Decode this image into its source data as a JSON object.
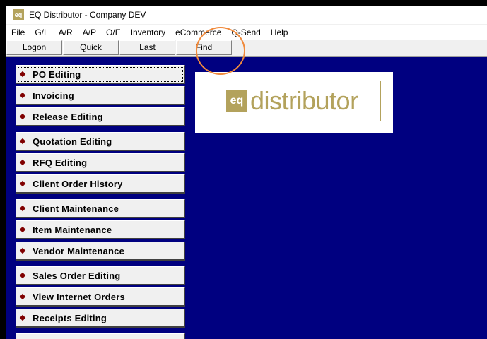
{
  "window": {
    "title": "EQ Distributor - Company DEV",
    "icon_text": "eq"
  },
  "menu": [
    "File",
    "G/L",
    "A/R",
    "A/P",
    "O/E",
    "Inventory",
    "eCommerce",
    "Q-Send",
    "Help"
  ],
  "toolbar": {
    "logon": "Logon",
    "quick": "Quick",
    "last": "Last",
    "find": "Find"
  },
  "nav": [
    {
      "label": "PO Editing"
    },
    {
      "label": "Invoicing"
    },
    {
      "label": "Release Editing"
    },
    {
      "label": "Quotation Editing"
    },
    {
      "label": "RFQ Editing"
    },
    {
      "label": "Client Order History"
    },
    {
      "label": "Client Maintenance"
    },
    {
      "label": "Item Maintenance"
    },
    {
      "label": "Vendor Maintenance"
    },
    {
      "label": "Sales Order Editing"
    },
    {
      "label": "View Internet Orders"
    },
    {
      "label": "Receipts Editing"
    }
  ],
  "logo": {
    "mark": "eq",
    "word": "distributor"
  },
  "colors": {
    "background": "#000080",
    "brand_gold": "#b3a25c",
    "bullet": "#800000",
    "highlight": "#f08a3c"
  }
}
